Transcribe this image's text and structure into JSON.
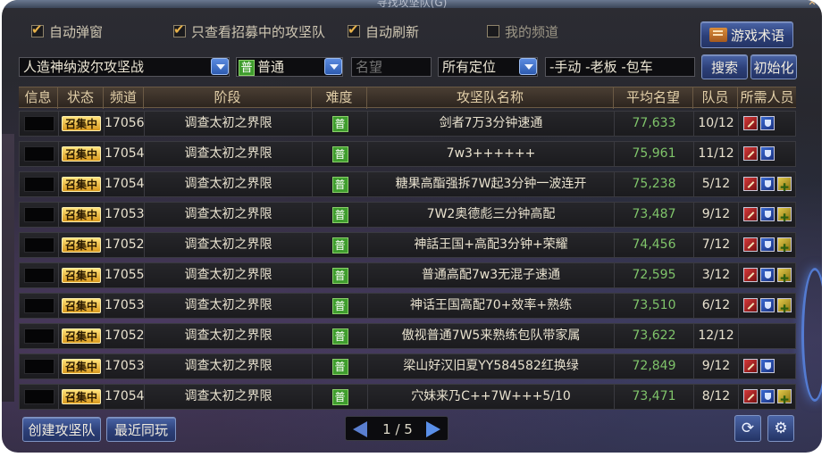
{
  "window": {
    "title": "寻找攻坚队(G)"
  },
  "filters": {
    "auto_popup": {
      "label": "自动弹窗",
      "checked": true
    },
    "only_recruiting": {
      "label": "只查看招募中的攻坚队",
      "checked": true
    },
    "auto_refresh": {
      "label": "自动刷新",
      "checked": true
    },
    "my_channel": {
      "label": "我的频道",
      "checked": false
    },
    "game_terms_button": "游戏术语",
    "raid_select": "人造神纳波尔攻坚战",
    "difficulty_badge": "普",
    "difficulty_select": "普通",
    "fame_placeholder": "名望",
    "position_select": "所有定位",
    "keyword_value": "-手动 -老板 -包车",
    "search_button": "搜索",
    "reset_button": "初始化"
  },
  "table": {
    "headers": [
      "信息",
      "状态",
      "频道",
      "阶段",
      "难度",
      "攻坚队名称",
      "平均名望",
      "队员",
      "所需人员"
    ],
    "rows": [
      {
        "status": "召集中",
        "channel": "17056",
        "stage": "调查太初之界限",
        "difficulty": "普",
        "name": "剑者7万3分钟速通",
        "fame": "77,633",
        "members": "10/12",
        "roles": [
          "sword-icon",
          "shield-icon"
        ]
      },
      {
        "status": "召集中",
        "channel": "17054",
        "stage": "调查太初之界限",
        "difficulty": "普",
        "name": "7w3++++++",
        "fame": "75,961",
        "members": "11/12",
        "roles": [
          "sword-icon",
          "shield-icon"
        ]
      },
      {
        "status": "召集中",
        "channel": "17054",
        "stage": "调查太初之界限",
        "difficulty": "普",
        "name": "糖果高酯强拆7W起3分钟一波连开",
        "fame": "75,238",
        "members": "5/12",
        "roles": [
          "sword-icon",
          "shield-icon",
          "plus-icon"
        ]
      },
      {
        "status": "召集中",
        "channel": "17053",
        "stage": "调查太初之界限",
        "difficulty": "普",
        "name": "7W2奥德彪三分钟高配",
        "fame": "73,487",
        "members": "9/12",
        "roles": [
          "sword-icon",
          "shield-icon",
          "plus-icon"
        ]
      },
      {
        "status": "召集中",
        "channel": "17052",
        "stage": "调查太初之界限",
        "difficulty": "普",
        "name": "神話王国+高配3分钟+荣耀",
        "fame": "74,456",
        "members": "7/12",
        "roles": [
          "sword-icon",
          "shield-icon",
          "plus-icon"
        ]
      },
      {
        "status": "召集中",
        "channel": "17055",
        "stage": "调查太初之界限",
        "difficulty": "普",
        "name": "普通高配7w3无混子速通",
        "fame": "72,595",
        "members": "3/12",
        "roles": [
          "sword-icon",
          "shield-icon",
          "plus-icon"
        ]
      },
      {
        "status": "召集中",
        "channel": "17053",
        "stage": "调查太初之界限",
        "difficulty": "普",
        "name": "神话王国高配70+效率+熟练",
        "fame": "73,510",
        "members": "6/12",
        "roles": [
          "sword-icon",
          "shield-icon",
          "plus-icon"
        ]
      },
      {
        "status": "召集中",
        "channel": "17052",
        "stage": "调查太初之界限",
        "difficulty": "普",
        "name": "傲视普通7W5来熟练包队带家属",
        "fame": "73,622",
        "members": "12/12",
        "roles": []
      },
      {
        "status": "召集中",
        "channel": "17053",
        "stage": "调查太初之界限",
        "difficulty": "普",
        "name": "梁山好汉旧夏YY584582红换绿",
        "fame": "72,849",
        "members": "9/12",
        "roles": [
          "sword-icon",
          "shield-icon"
        ]
      },
      {
        "status": "召集中",
        "channel": "17054",
        "stage": "调查太初之界限",
        "difficulty": "普",
        "name": "穴妹来乃C++7W+++5/10",
        "fame": "73,471",
        "members": "8/12",
        "roles": [
          "sword-icon",
          "shield-icon",
          "plus-icon"
        ]
      }
    ]
  },
  "footer": {
    "create_button": "创建攻坚队",
    "recent_button": "最近同玩",
    "page_text": "1 / 5",
    "refresh_icon": "refresh-icon",
    "settings_icon": "gear-icon"
  }
}
